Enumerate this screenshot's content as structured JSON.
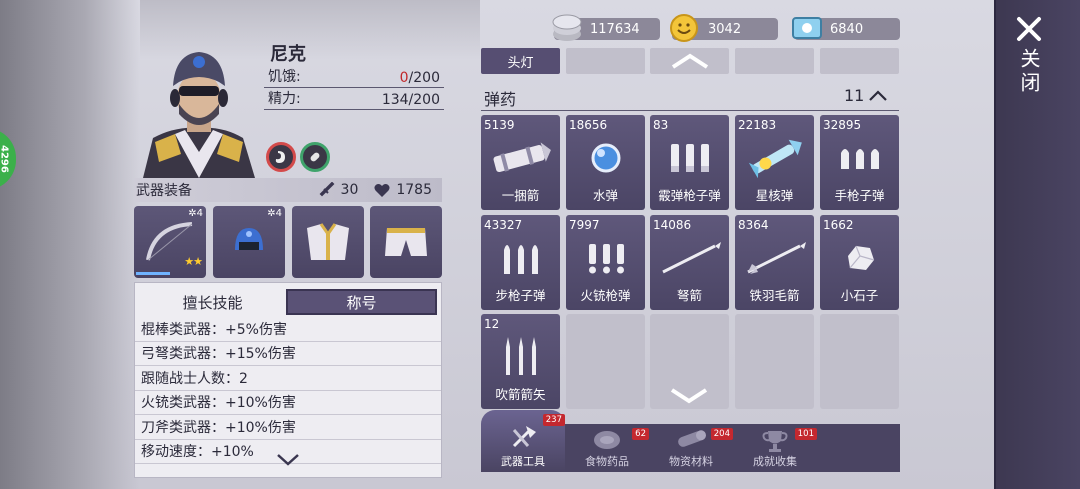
{
  "side_badge": "4296",
  "character": {
    "name": "尼克",
    "hunger_label": "饥饿:",
    "hunger_current": "0",
    "hunger_max": "/200",
    "energy_label": "精力:",
    "energy_value": "134/200"
  },
  "equipment": {
    "header": "武器装备",
    "attack": "30",
    "health": "1785",
    "slots": [
      {
        "name": "bow",
        "level": "4",
        "stars": "★★",
        "progress": 0.5
      },
      {
        "name": "helmet",
        "level": "4"
      },
      {
        "name": "armor"
      },
      {
        "name": "pants"
      }
    ]
  },
  "skills": {
    "tab_skills": "擅长技能",
    "tab_title": "称号",
    "lines": [
      "棍棒类武器：+5%伤害",
      "弓弩类武器：+15%伤害",
      "跟随战士人数：2",
      "火铳类武器：+10%伤害",
      "刀斧类武器：+10%伤害",
      "移动速度：+10%"
    ]
  },
  "currency": {
    "silver": "117634",
    "gold": "3042",
    "tickets": "6840"
  },
  "inventory": {
    "top_label": "头灯",
    "section_title": "弹药",
    "section_count": "11",
    "items": [
      {
        "qty": "5139",
        "name": "一捆箭",
        "icon": "arrow-bundle"
      },
      {
        "qty": "18656",
        "name": "水弹",
        "icon": "water-orb"
      },
      {
        "qty": "83",
        "name": "霰弹枪子弹",
        "icon": "shotgun-shells"
      },
      {
        "qty": "22183",
        "name": "星核弹",
        "icon": "star-core-bomb"
      },
      {
        "qty": "32895",
        "name": "手枪子弹",
        "icon": "pistol-bullets"
      },
      {
        "qty": "43327",
        "name": "步枪子弹",
        "icon": "rifle-bullets"
      },
      {
        "qty": "7997",
        "name": "火铳枪弹",
        "icon": "musket-rounds"
      },
      {
        "qty": "14086",
        "name": "弩箭",
        "icon": "crossbow-bolt"
      },
      {
        "qty": "8364",
        "name": "铁羽毛箭",
        "icon": "iron-feather-arrow"
      },
      {
        "qty": "1662",
        "name": "小石子",
        "icon": "pebble"
      },
      {
        "qty": "12",
        "name": "吹箭箭矢",
        "icon": "blow-darts"
      }
    ]
  },
  "bottom_tabs": [
    {
      "label": "武器工具",
      "badge": "237",
      "active": true
    },
    {
      "label": "食物药品",
      "badge": "62"
    },
    {
      "label": "物资材料",
      "badge": "204"
    },
    {
      "label": "成就收集",
      "badge": "101"
    }
  ],
  "close_label": "关闭"
}
